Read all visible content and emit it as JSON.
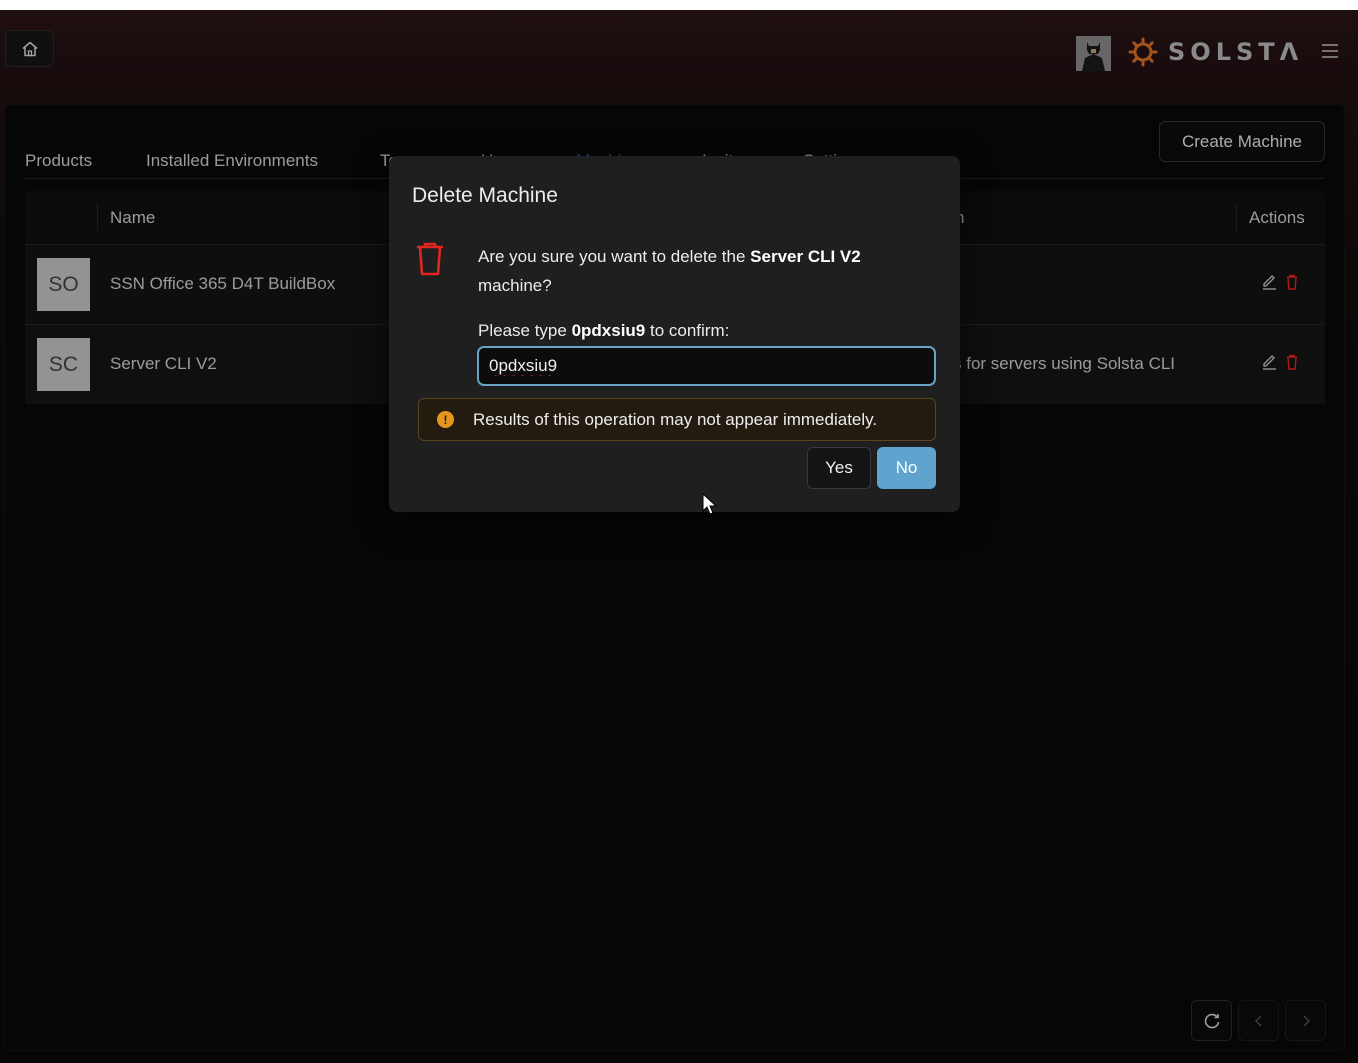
{
  "header": {
    "home_icon": "home-icon",
    "brand": "SOLSTΛ",
    "menu_icon": "hamburger-menu-icon"
  },
  "tabs": [
    {
      "label": "Products"
    },
    {
      "label": "Installed Environments"
    },
    {
      "label": "Teams"
    },
    {
      "label": "Users"
    },
    {
      "label": "Machines",
      "active": true
    },
    {
      "label": "Invites"
    },
    {
      "label": "Settings"
    }
  ],
  "create_button": "Create Machine",
  "table": {
    "columns": [
      "Name",
      "n",
      "Actions"
    ],
    "rows": [
      {
        "initials": "SO",
        "name": "SSN Office 365 D4T BuildBox",
        "description": ""
      },
      {
        "initials": "SC",
        "name": "Server CLI V2",
        "description": "s for servers using Solsta CLI"
      }
    ]
  },
  "modal": {
    "title": "Delete Machine",
    "message_prefix": "Are you sure you want to delete the ",
    "machine_name": "Server CLI V2",
    "message_suffix": " machine?",
    "confirm_prefix": "Please type ",
    "confirm_code": "0pdxsiu9",
    "confirm_suffix": " to confirm:",
    "input_value": "0pdxsiu9",
    "warning_icon": "!",
    "warning": "Results of this operation may not appear immediately.",
    "yes": "Yes",
    "no": "No"
  },
  "colors": {
    "active_tab": "#2d70b8",
    "primary_button": "#5fa4cf",
    "danger": "#e0261f",
    "warning": "#e6951e"
  }
}
